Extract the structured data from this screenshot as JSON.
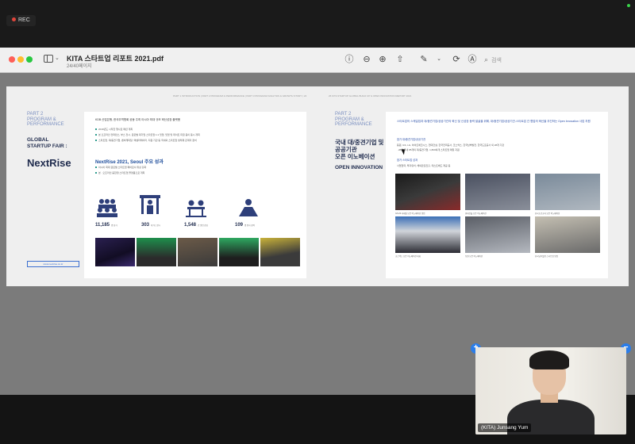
{
  "recording": {
    "label": "REC"
  },
  "pdf": {
    "title": "KITA 스타트업 리포트 2021.pdf",
    "page_indicator": "24/40페이지",
    "search_placeholder": "검색"
  },
  "left_page": {
    "header": "PART 1 INTRODUCTION  |  PART 2 PROGRAM & PERFORMANCE  |  PART 3 PROGRAM ANALYSIS & GROWTH STORY  |  24",
    "part": "PART 2\nPROGRAM &\nPERFORMANCE",
    "section_title": "GLOBAL\nSTARTUP FAIR :",
    "brand": "NextRise",
    "url": "www.nextrise.co.kr",
    "intro": "KDB 산업은행, 한국무역협회 공동 주최 아시아 최대 규모 혁신성장 플랫폼",
    "bullets": [
      "2019년도 시작한 행사로 매년 개최",
      "본 오프라인 컨퍼런스, 부스 전시, 글로벌 대기업·스타트업 1:1 밋업, 밋업 및 데이트 피칭 등이 동시 개최",
      "스타트업, 대/중견기업, 벤처캐피탈, 액셀러레이터, 지원 기관 등 국내외 스타트업 생태계 관계자 참석"
    ],
    "result_title": "NextRise 2021, Seoul 주요 성과",
    "result_bullets": [
      "아시아 최대 글로벌 스타트업 페어로서 위상 강화",
      "본 · 오프라인 융합형 스타트업 플랫폼으로 개최"
    ],
    "stats": [
      {
        "value": "11,185",
        "unit": "명 참가"
      },
      {
        "value": "303",
        "unit": "개 부스전시"
      },
      {
        "value": "1,548",
        "unit": "건 밋업 상담"
      },
      {
        "value": "109",
        "unit": "명 연사 참여"
      }
    ]
  },
  "right_page": {
    "header": "26  KITA STARTUP GLOBAL BUILD UP & OPEN INNOVATION REPORT 2021",
    "part": "PART 2\nPROGRAM &\nPERFORMANCE",
    "title_ko": "국내 대/중견기업 및\n공공기관\n오픈 이노베이션",
    "title_en": "OPEN INNOVATION",
    "intro": "스타트업의 스케일업과 대/중견기업/공공기관의 혁신 및 신성장 동력 발굴을 위해, 대/중견기업/공공기관-스타트업 간 협업의 혁신을 추진하는 Open Innovation 사업 지원",
    "label1": "참가 대/중견기업/공공기관",
    "text1": "동원, GS, LG, 하이트에코시스, 현대건설, 한국전력공사, 코스맥스, 한국남부발전, 한국도로공사 외 28개 기관",
    "text2": "· 28년 국내 85개의 대/중견기업, 1,800여개 스타트업 매칭 지원",
    "label2": "참가 스타트업 성과",
    "text3": "사업협력, 투자유치, 해외판로진출, 테스트베드 제공 등",
    "captions": [
      "GS 20 리테일 오픈 이노베이션 밋업",
      "현대건설 오픈 이노베이션",
      "한국도로공사 오픈 이노베이션",
      "코스맥스 오픈 이노베이션 대회",
      "동원 오픈 이노베이션",
      "한국남부발전 스타트업 밋업"
    ]
  },
  "video": {
    "participant_name": "(KITA) Junsang Yum"
  },
  "colors": {
    "accent": "#2b7de9",
    "brand_navy": "#1f2b4d",
    "part_blue": "#7a8fc0"
  }
}
